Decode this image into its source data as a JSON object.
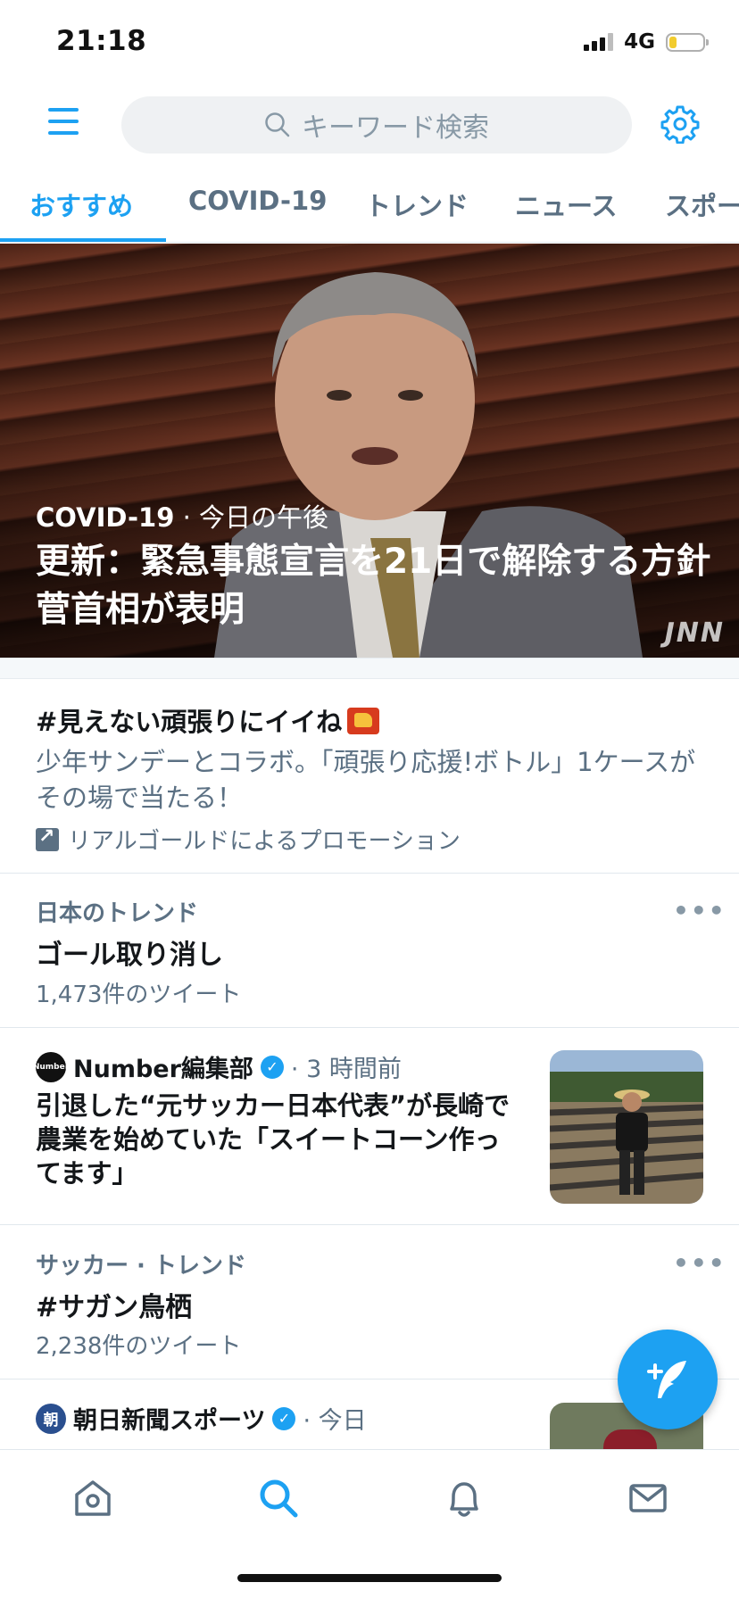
{
  "status_bar": {
    "time": "21:18",
    "network": "4G"
  },
  "search": {
    "placeholder": "キーワード検索"
  },
  "tabs": [
    {
      "label": "おすすめ",
      "active": true
    },
    {
      "label": "COVID-19",
      "active": false
    },
    {
      "label": "トレンド",
      "active": false
    },
    {
      "label": "ニュース",
      "active": false
    },
    {
      "label": "スポー",
      "active": false
    }
  ],
  "hero": {
    "category": "COVID-19",
    "time": " · 今日の午後",
    "headline": "更新：緊急事態宣言を21日で解除する方針 菅首相が表明",
    "watermark": "JNN"
  },
  "promo": {
    "title": "#見えない頑張りにイイね",
    "description": "少年サンデーとコラボ。「頑張り応援!ボトル」1ケースがその場で当たる！",
    "promoted_by": "リアルゴールドによるプロモーション"
  },
  "trends": [
    {
      "category": "日本のトレンド",
      "title": "ゴール取り消し",
      "count": "1,473件のツイート"
    },
    {
      "category": "サッカー · トレンド",
      "title": "#サガン鳥栖",
      "count": "2,238件のツイート"
    }
  ],
  "news": [
    {
      "source": "Number編集部",
      "avatar_text": "Number",
      "time": "· 3 時間前",
      "headline": "引退した“元サッカー日本代表”が長崎で農業を始めていた「スイートコーン作ってます」"
    },
    {
      "source": "朝日新聞スポーツ",
      "avatar_text": "朝",
      "time": "· 今日",
      "headline": ""
    }
  ],
  "more_symbol": "•••",
  "colors": {
    "accent": "#1da1f2",
    "secondary_text": "#5b7083",
    "divider": "#e1e8ed"
  },
  "icons": [
    "menu-icon",
    "search-icon",
    "gear-icon",
    "home-icon",
    "bell-icon",
    "mail-icon",
    "compose-icon",
    "verified-icon",
    "promoted-icon"
  ]
}
